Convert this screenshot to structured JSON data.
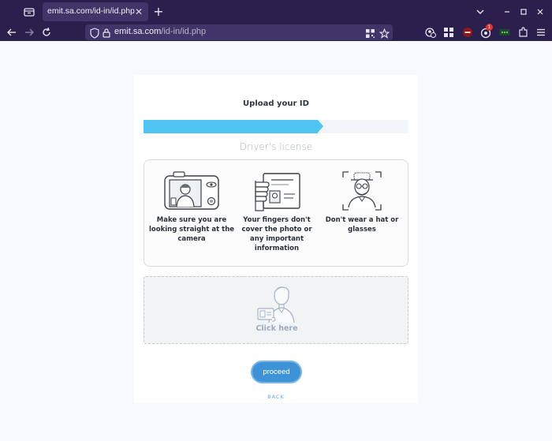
{
  "browser": {
    "tab_title": "emit.sa.com/id-in/id.php",
    "url_host": "emit.sa.com",
    "url_path": "/id-in/id.php",
    "notification_badge": "1"
  },
  "page": {
    "heading": "Upload your ID",
    "progress": 0.68,
    "document_type": "Driver's license",
    "tips": [
      {
        "text": "Make sure you are looking straight at the camera",
        "icon": "camera-selfie-icon"
      },
      {
        "text": "Your fingers don't cover the photo or any important information",
        "icon": "hand-holding-id-icon"
      },
      {
        "text": "Don't wear a hat or glasses",
        "icon": "person-hat-glasses-icon"
      }
    ],
    "upload_label": "Click here",
    "proceed_label": "proceed",
    "back_label": "BACK"
  },
  "colors": {
    "accent": "#4fc3f1",
    "button": "#3d93d6",
    "browser_chrome": "#2b1f4e"
  }
}
